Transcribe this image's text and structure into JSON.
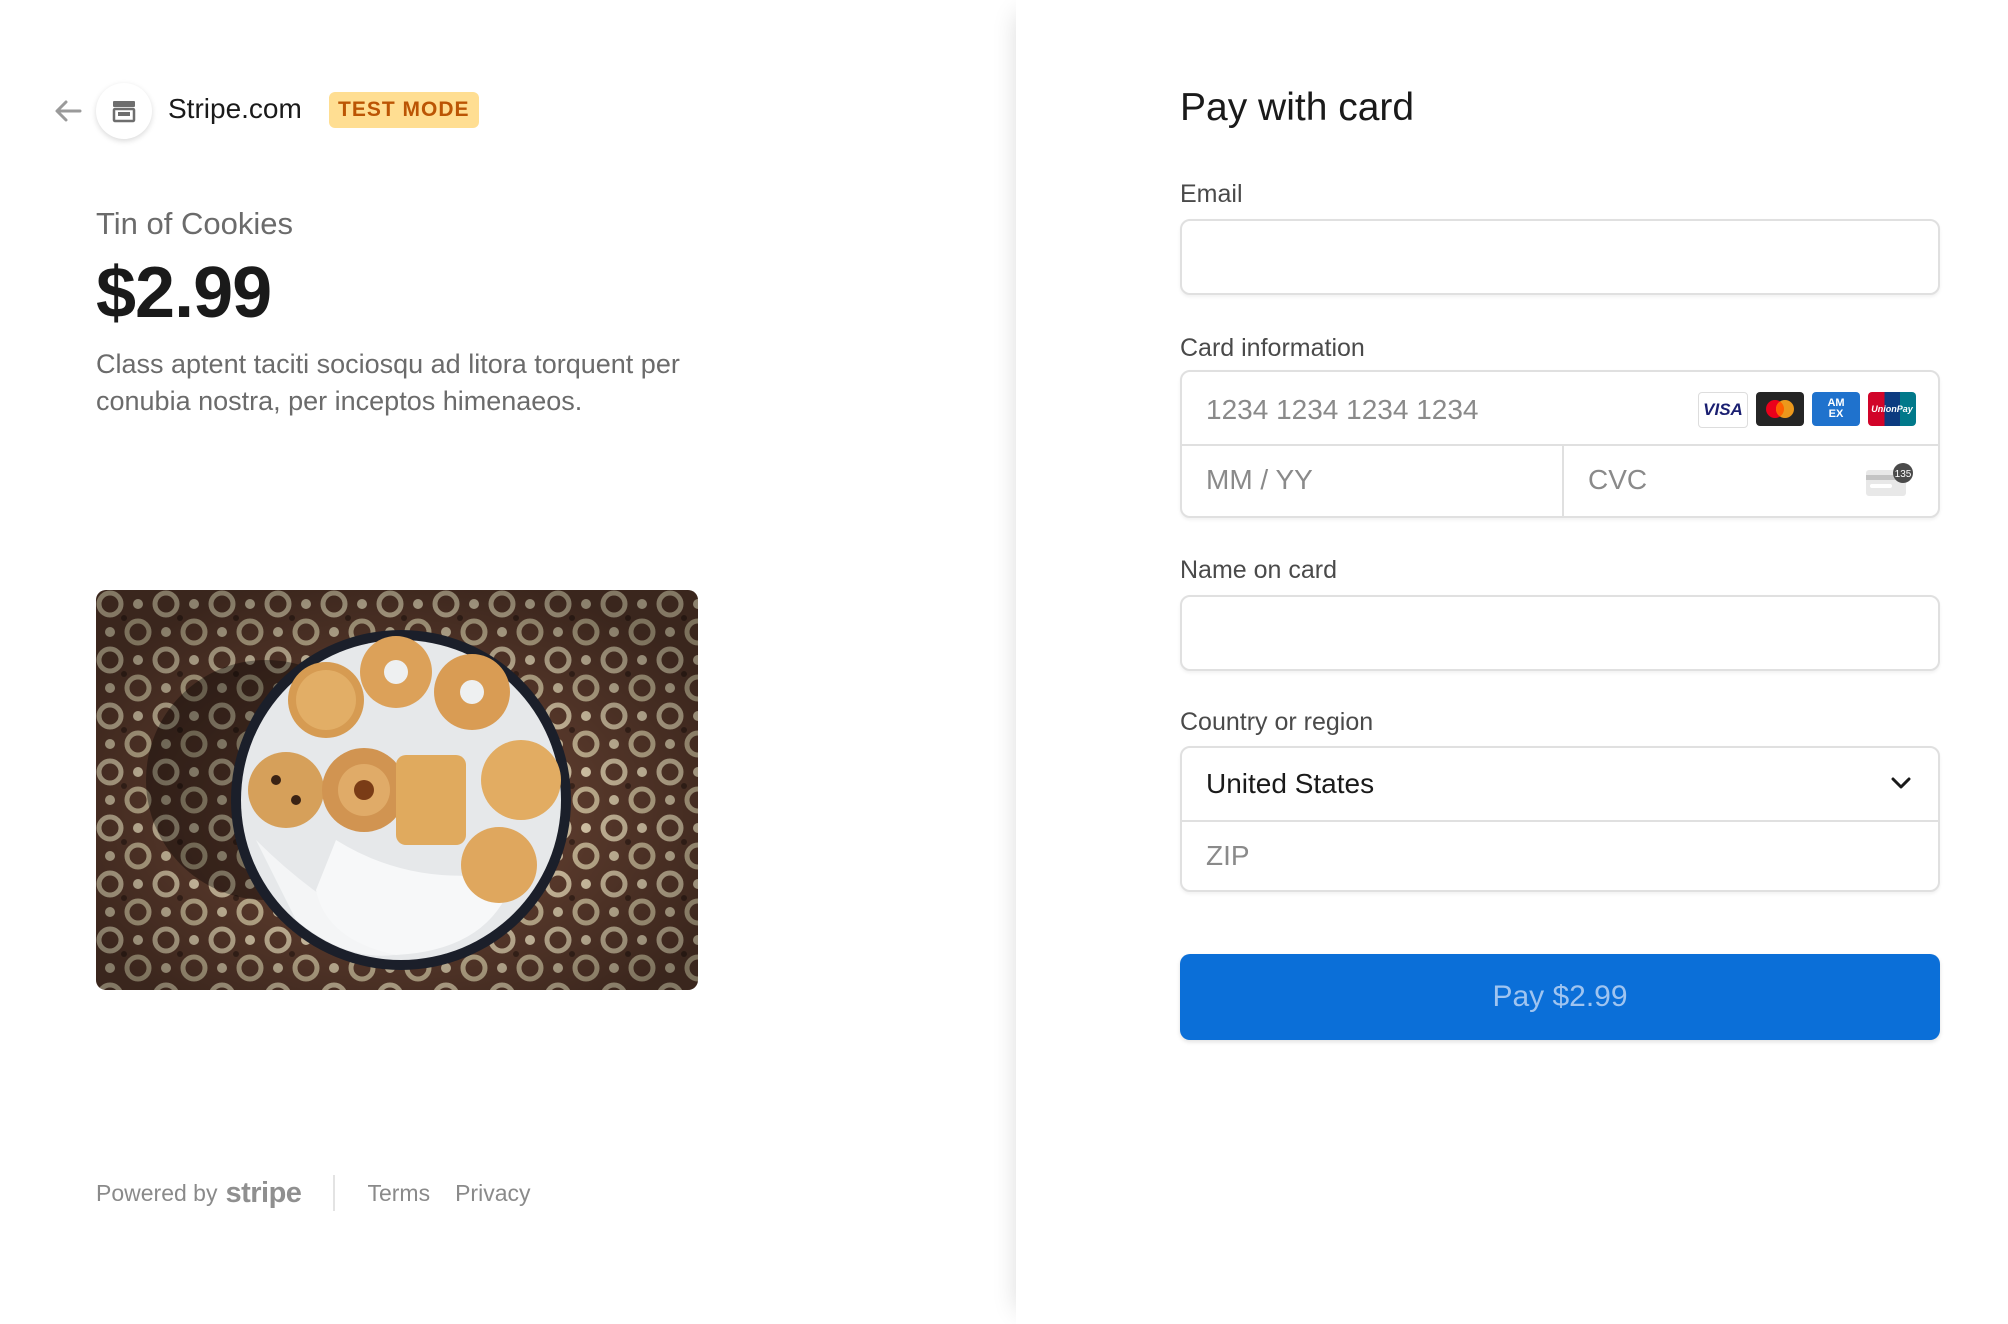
{
  "merchant": {
    "name": "Stripe.com",
    "badge": "TEST MODE"
  },
  "product": {
    "name": "Tin of Cookies",
    "price": "$2.99",
    "description": "Class aptent taciti sociosqu ad litora torquent per conubia nostra, per inceptos himenaeos."
  },
  "footer": {
    "powered_by": "Powered by",
    "brand": "stripe",
    "links": [
      "Terms",
      "Privacy"
    ]
  },
  "form": {
    "title": "Pay with card",
    "email_label": "Email",
    "email_value": "",
    "card_label": "Card information",
    "card_number_placeholder": "1234 1234 1234 1234",
    "expiry_placeholder": "MM / YY",
    "cvc_placeholder": "CVC",
    "card_brands": [
      "VISA",
      "Mastercard",
      "AMEX",
      "UnionPay"
    ],
    "cvc_icon_text": "135",
    "name_label": "Name on card",
    "name_value": "",
    "country_label": "Country or region",
    "country_value": "United States",
    "zip_placeholder": "ZIP",
    "pay_button": "Pay $2.99"
  },
  "icons": {
    "back": "arrow-left-icon",
    "merchant": "storefront-icon",
    "dropdown": "chevron-down-icon",
    "cvc": "card-cvc-icon"
  },
  "colors": {
    "accent": "#0b6fd8",
    "badge_bg": "#ffde92",
    "badge_text": "#bb5504"
  }
}
